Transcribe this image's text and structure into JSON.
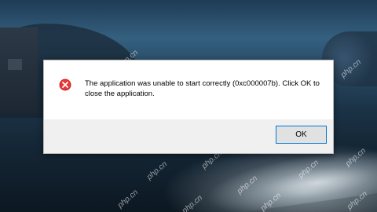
{
  "dialog": {
    "message": "The application was unable to start correctly (0xc000007b). Click OK to close the application.",
    "ok_label": "OK",
    "icon": "error-icon"
  },
  "watermark": {
    "text": "php.cn"
  },
  "colors": {
    "error_red": "#d32f2f",
    "button_border": "#0078d7",
    "footer_bg": "#f0f0f0"
  }
}
